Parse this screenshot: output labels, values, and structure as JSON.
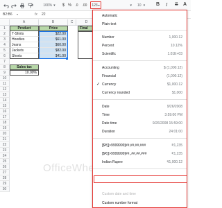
{
  "toolbar": {
    "zoom": "100%",
    "currency_symbol": "$",
    "percent_symbol": "%",
    "decimal_decrease": ".0",
    "decimal_increase": ".00",
    "format_button_label": "123",
    "font_size": "10",
    "bold": "B",
    "italic": "I",
    "strike": "S",
    "text_color": "A"
  },
  "formula_bar": {
    "cell_ref": "B2:B6",
    "fx": "fx",
    "value": "22"
  },
  "grid": {
    "columns": [
      "A",
      "B",
      "C",
      "D"
    ],
    "rows": [
      "1",
      "2",
      "3",
      "4",
      "5",
      "6",
      "7",
      "8",
      "9",
      "10",
      "11",
      "12",
      "13",
      "14",
      "15",
      "16",
      "17",
      "18",
      "19",
      "20",
      "21",
      "22",
      "23",
      "24",
      "25",
      "26",
      "27",
      "28",
      "29",
      "30"
    ],
    "header": {
      "product": "Product",
      "price": "Price",
      "final": "Final"
    },
    "products": [
      "T-Shirts",
      "Hoodies",
      "Jeans",
      "Jackets",
      "Shorts"
    ],
    "prices": [
      "$22.00",
      "$61.00",
      "$60.00",
      "$82.00",
      "$41.00"
    ],
    "sales_tax_label": "Sales tax",
    "sales_tax_value": "10.00%"
  },
  "menu": {
    "automatic": "Automatic",
    "plain_text": "Plain text",
    "number": {
      "label": "Number",
      "sample": "1,000.12"
    },
    "percent": {
      "label": "Percent",
      "sample": "10.12%"
    },
    "scientific": {
      "label": "Scientific",
      "sample": "1.01E+03"
    },
    "accounting": {
      "label": "Accounting",
      "sample": "$ (1,000.12)"
    },
    "financial": {
      "label": "Financial",
      "sample": "(1,000.12)"
    },
    "currency": {
      "label": "Currency",
      "sample": "$1,000.12",
      "checked": true
    },
    "currency_rounded": {
      "label": "Currency rounded",
      "sample": "$1,000"
    },
    "date": {
      "label": "Date",
      "sample": "9/26/2008"
    },
    "time": {
      "label": "Time",
      "sample": "3:59:00 PM"
    },
    "date_time": {
      "label": "Date time",
      "sample": "9/26/2008 15:59:00"
    },
    "duration": {
      "label": "Duration",
      "sample": "24:01:00"
    },
    "custom1": {
      "label": "[$₹][>9999999]##,##,##,###",
      "sample": "₹1,235"
    },
    "custom2": {
      "label": "[$₹][>9999999]##,,##,##,###",
      "sample": "₹1,235"
    },
    "indian_rupee": {
      "label": "Indian Rupee",
      "sample": "₹1,000.12"
    },
    "more_formats": "",
    "custom_date_time": "Custom date and time",
    "custom_number_format": "Custom number format"
  },
  "watermark": "OfficeWheel",
  "colors": {
    "highlight": "#e53935",
    "header_green": "#b7d7a8",
    "price_blue": "#cfe2f3",
    "selection": "#1a73e8"
  }
}
